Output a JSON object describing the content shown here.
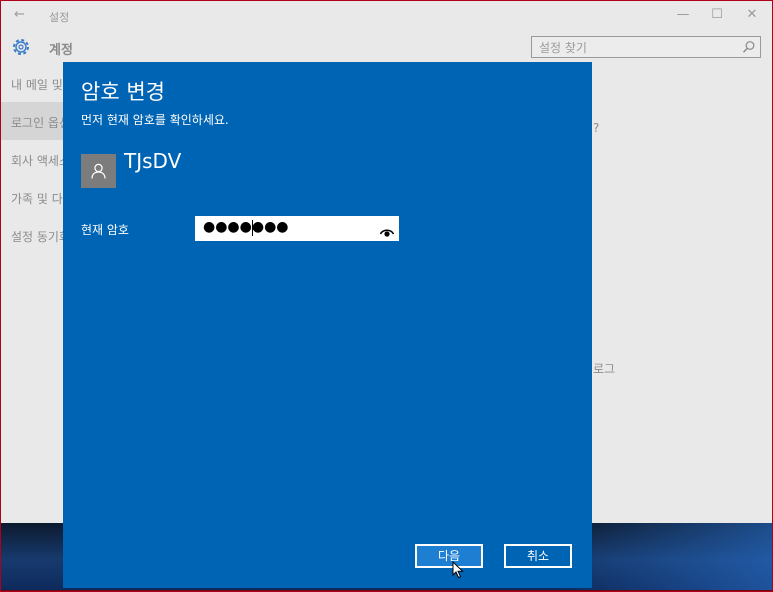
{
  "window": {
    "title": "설정",
    "back_glyph": "←",
    "minimize_glyph": "—",
    "maximize_glyph": "☐",
    "close_glyph": "✕"
  },
  "header": {
    "title": "계정",
    "search_placeholder": "설정 찾기"
  },
  "sidebar": {
    "items": [
      {
        "label": "내 메일 및 계정"
      },
      {
        "label": "로그인 옵션",
        "selected": true
      },
      {
        "label": "회사 액세스"
      },
      {
        "label": "가족 및 다른 사용자"
      },
      {
        "label": "설정 동기화"
      }
    ]
  },
  "background_fragments": {
    "question_mark": "?",
    "logo_fragment": "로그"
  },
  "dialog": {
    "title": "암호 변경",
    "subtitle": "먼저 현재 암호를 확인하세요.",
    "user_name": "TJsDV",
    "password_label": "현재 암호",
    "password_value": "●●●●●●●",
    "next_label": "다음",
    "cancel_label": "취소"
  },
  "colors": {
    "dialog_bg": "#0064b4",
    "next_button_bg": "#1e7fd2",
    "frame_border": "#b0001a"
  }
}
